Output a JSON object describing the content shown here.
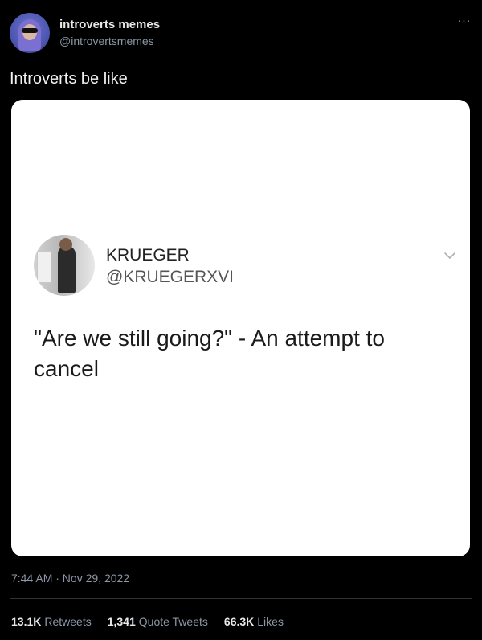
{
  "tweet": {
    "author": {
      "display_name": "introverts memes",
      "handle": "@introvertsmemes"
    },
    "text": "Introverts be like",
    "timestamp": "7:44 AM · Nov 29, 2022",
    "stats": [
      {
        "value": "13.1K",
        "label": "Retweets"
      },
      {
        "value": "1,341",
        "label": "Quote Tweets"
      },
      {
        "value": "66.3K",
        "label": "Likes"
      }
    ],
    "more_icon": "more-horizontal-icon"
  },
  "embedded_tweet": {
    "display_name": "KRUEGER",
    "handle": "@KRUEGERXVI",
    "text": "\"Are we still going?\" - An attempt to cancel",
    "chevron_icon": "chevron-down-icon"
  },
  "colors": {
    "background": "#000000",
    "card_background": "#ffffff",
    "muted_text": "#8b98a5"
  }
}
